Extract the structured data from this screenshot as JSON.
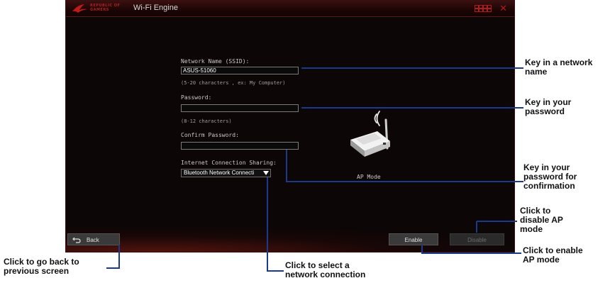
{
  "window": {
    "brand_line1": "REPUBLIC OF",
    "brand_line2": "GAMERS",
    "title": "Wi-Fi Engine"
  },
  "form": {
    "ssid_label": "Network Name (SSID):",
    "ssid_value": "ASUS-51060",
    "ssid_hint": "(5-20 characters , ex: My Computer)",
    "password_label": "Password:",
    "password_value": "",
    "password_hint": "(8-12 characters)",
    "confirm_label": "Confirm Password:",
    "confirm_value": "",
    "sharing_label": "Internet Connection Sharing:",
    "sharing_selected": "Bluetooth Network Connecti"
  },
  "device": {
    "label": "AP Mode"
  },
  "buttons": {
    "back": "Back",
    "enable": "Enable",
    "disable": "Disable"
  },
  "callouts": {
    "ssid_1": "Key in a network",
    "ssid_2": "name",
    "password_1": "Key in your",
    "password_2": "password",
    "confirm_1": "Key in your",
    "confirm_2": "password for",
    "confirm_3": "confirmation",
    "disable_1": "Click to",
    "disable_2": "disable AP",
    "disable_3": "mode",
    "enable_1": "Click to enable",
    "enable_2": "AP mode",
    "back_1": "Click to go back to",
    "back_2": "previous screen",
    "select_1": "Click to select a",
    "select_2": "network connection"
  },
  "colors": {
    "accent": "#b01c1c",
    "leader_line": "#1a3a8a",
    "window_bg": "#0d0606"
  }
}
